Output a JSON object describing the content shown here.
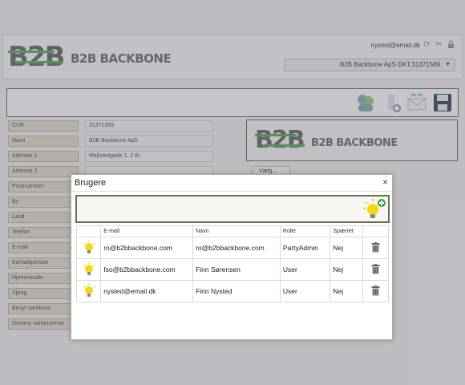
{
  "header": {
    "logo_text": "B2B BACKBONE",
    "logo_mark": "B2B",
    "user_email": "nysted@email.dk",
    "company_select": "B2B Backbone ApS DKT:31371589",
    "icons": [
      "refresh-icon",
      "tools-icon",
      "lock-icon"
    ]
  },
  "toolbar": {
    "icons": [
      "users-icon",
      "scanner-icon",
      "email-icon",
      "save-icon"
    ]
  },
  "form": {
    "fields": [
      {
        "label": "CVR",
        "value": "31371589"
      },
      {
        "label": "Navn",
        "value": "B2B Backbone ApS"
      },
      {
        "label": "Adresse 1",
        "value": "Mejlstedgade 1, 2.th."
      },
      {
        "label": "Adresse 2",
        "value": ""
      },
      {
        "label": "Postnummer",
        "value": ""
      },
      {
        "label": "By",
        "value": ""
      },
      {
        "label": "Land",
        "value": ""
      },
      {
        "label": "Telefon",
        "value": ""
      },
      {
        "label": "E-mail",
        "value": ""
      },
      {
        "label": "Kontaktperson",
        "value": ""
      },
      {
        "label": "Hjemmeside",
        "value": ""
      },
      {
        "label": "Sprog",
        "value": ""
      },
      {
        "label": "Benyt varekonv.",
        "value": ""
      },
      {
        "label": "Dummy varenummer",
        "value": ""
      }
    ],
    "upload_label": "Vælg..."
  },
  "dialog": {
    "title": "Brugere",
    "close": "×",
    "columns": [
      "",
      "E-mail",
      "Navn",
      "Rolle",
      "Spærret",
      ""
    ],
    "rows": [
      {
        "email": "ro@b2bbackbone.com",
        "name": "ro@b2bbackbone.com",
        "role": "PartyAdmin",
        "blocked": "Nej"
      },
      {
        "email": "fso@b2bbackbone.com",
        "name": "Finn Sørensen",
        "role": "User",
        "blocked": "Nej"
      },
      {
        "email": "nysted@email.dk",
        "name": "Finn Nysted",
        "role": "User",
        "blocked": "Nej"
      }
    ]
  },
  "colors": {
    "accent_green": "#3fa43f",
    "label_bg": "#e0d4c2",
    "toolbar_border": "#6d6b52"
  }
}
